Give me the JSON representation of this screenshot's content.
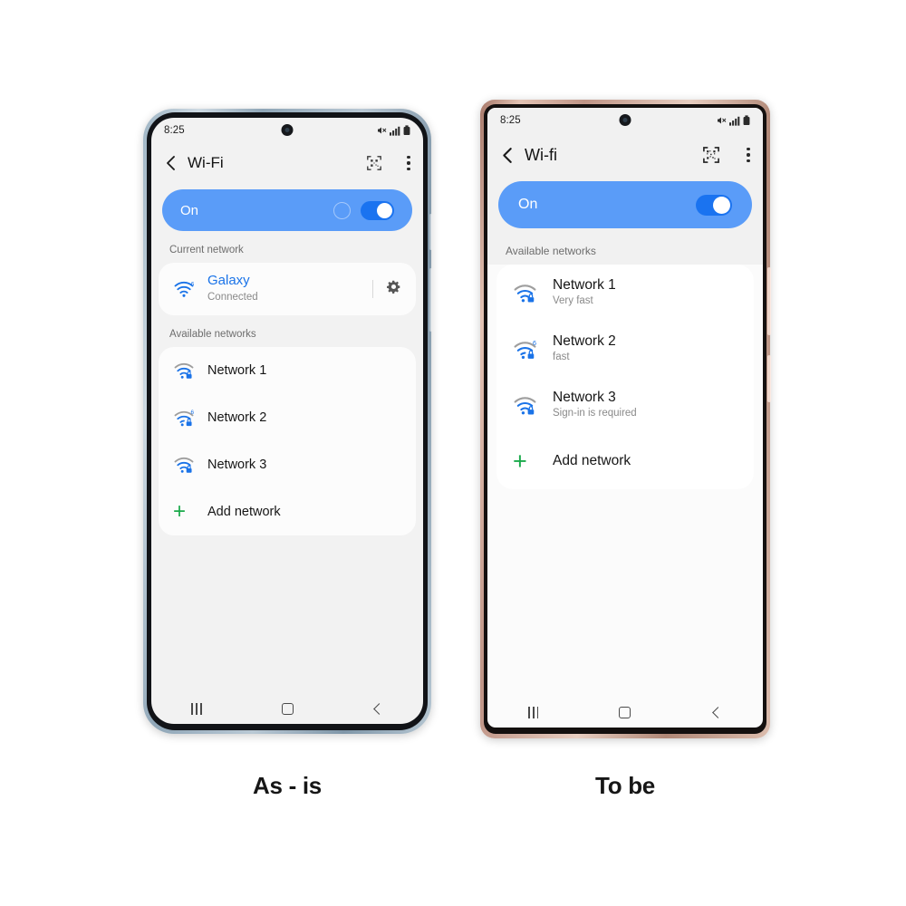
{
  "page": {
    "background": "#ffffff",
    "accent_blue": "#5a9cf8",
    "toggle_blue": "#1a73f0",
    "link_blue": "#1a73e8",
    "green": "#1aaa4b"
  },
  "phones": [
    {
      "id": "as-is",
      "caption": "As - is",
      "frame_color": "#a9bfcd",
      "statusbar": {
        "time": "8:25",
        "icons": [
          "mute-icon",
          "signal-bars-icon",
          "battery-icon"
        ]
      },
      "appbar": {
        "back_icon": "back-chevron-icon",
        "title": "Wi-Fi",
        "scan_icon": "qr-scan-icon",
        "menu_icon": "kebab-menu-icon"
      },
      "toggle": {
        "label": "On",
        "state": "on",
        "has_spinner": true
      },
      "sections": [
        {
          "label": "Current network",
          "rows": [
            {
              "icon": "wifi-6-icon",
              "primary": "Galaxy",
              "secondary": "Connected",
              "highlight": true,
              "trailing_icon": "gear-icon"
            }
          ]
        },
        {
          "label": "Available networks",
          "rows": [
            {
              "icon": "wifi-lock-icon",
              "primary": "Network 1",
              "secondary": ""
            },
            {
              "icon": "wifi-6-lock-icon",
              "primary": "Network 2",
              "secondary": ""
            },
            {
              "icon": "wifi-lock-icon",
              "primary": "Network 3",
              "secondary": ""
            },
            {
              "icon": "plus-icon",
              "primary": "Add network",
              "secondary": ""
            }
          ]
        }
      ],
      "navbar": [
        "recents-icon",
        "home-icon",
        "back-icon"
      ]
    },
    {
      "id": "to-be",
      "caption": "To be",
      "frame_color": "#c6a08f",
      "statusbar": {
        "time": "8:25",
        "icons": [
          "mute-icon",
          "signal-bars-icon",
          "battery-icon"
        ]
      },
      "appbar": {
        "back_icon": "back-chevron-icon",
        "title": "Wi-fi",
        "scan_icon": "qr-scan-icon",
        "menu_icon": "kebab-menu-icon"
      },
      "toggle": {
        "label": "On",
        "state": "on",
        "has_spinner": false
      },
      "sections": [
        {
          "label": "Available networks",
          "rows": [
            {
              "icon": "wifi-lock-icon",
              "primary": "Network 1",
              "secondary": "Very fast"
            },
            {
              "icon": "wifi-6-lock-icon",
              "primary": "Network 2",
              "secondary": "fast"
            },
            {
              "icon": "wifi-lock-icon",
              "primary": "Network 3",
              "secondary": "Sign-in is required"
            },
            {
              "icon": "plus-icon",
              "primary": "Add network",
              "secondary": ""
            }
          ]
        }
      ],
      "navbar": [
        "recents-icon",
        "home-icon",
        "back-icon"
      ]
    }
  ]
}
